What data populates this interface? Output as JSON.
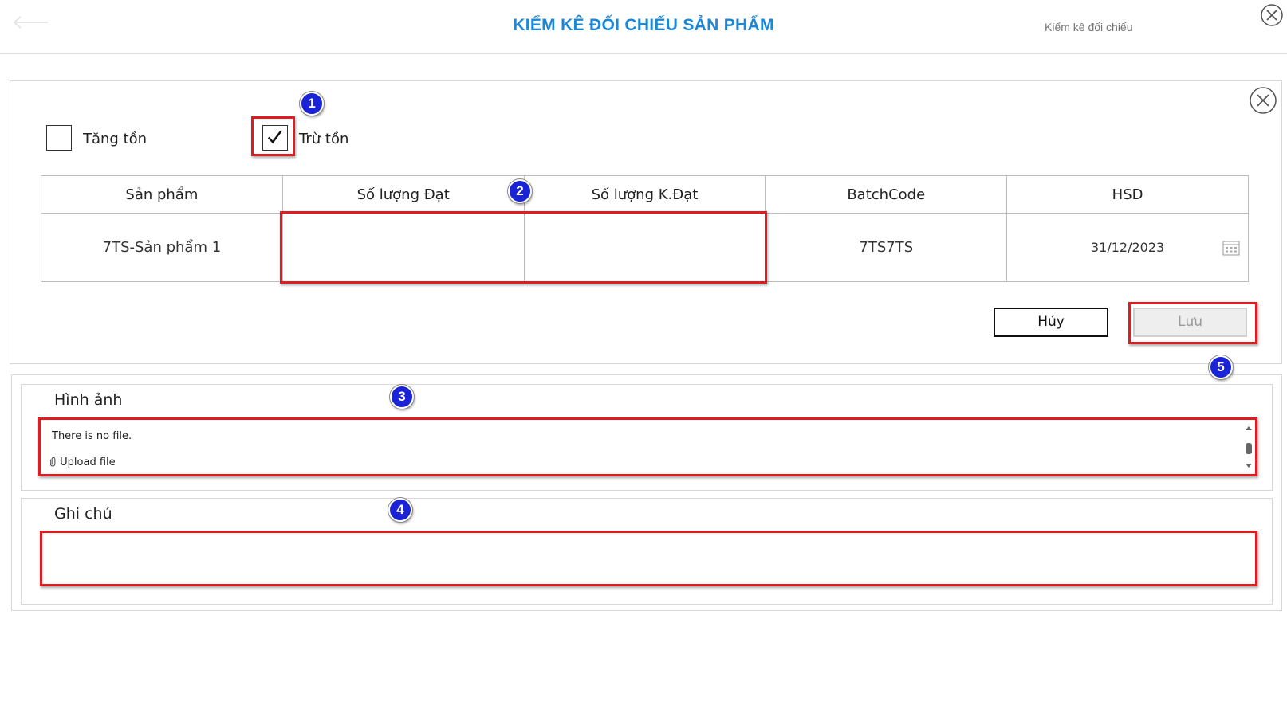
{
  "header": {
    "title": "KIỂM KÊ ĐỐI CHIẾU SẢN PHẨM",
    "search_placeholder": "Kiểm kê đối chiếu"
  },
  "options": {
    "increase_label": "Tăng tồn",
    "increase_checked": false,
    "decrease_label": "Trừ tồn",
    "decrease_checked": true
  },
  "table": {
    "headers": [
      "Sản phẩm",
      "Số lượng Đạt",
      "Số lượng K.Đạt",
      "BatchCode",
      "HSD"
    ],
    "rows": [
      {
        "product": "7TS-Sản phẩm 1",
        "qty_pass": "",
        "qty_fail": "",
        "batch": "7TS7TS",
        "expiry": "31/12/2023"
      }
    ]
  },
  "actions": {
    "cancel_label": "Hủy",
    "save_label": "Lưu"
  },
  "images": {
    "title": "Hình ảnh",
    "no_file_text": "There is no file.",
    "upload_label": "Upload file"
  },
  "notes": {
    "title": "Ghi chú",
    "value": ""
  },
  "annotations": [
    "1",
    "2",
    "3",
    "4",
    "5"
  ],
  "colors": {
    "title_blue": "#1b87d6",
    "highlight_red": "#e01b22",
    "badge_blue": "#1a24d6"
  }
}
